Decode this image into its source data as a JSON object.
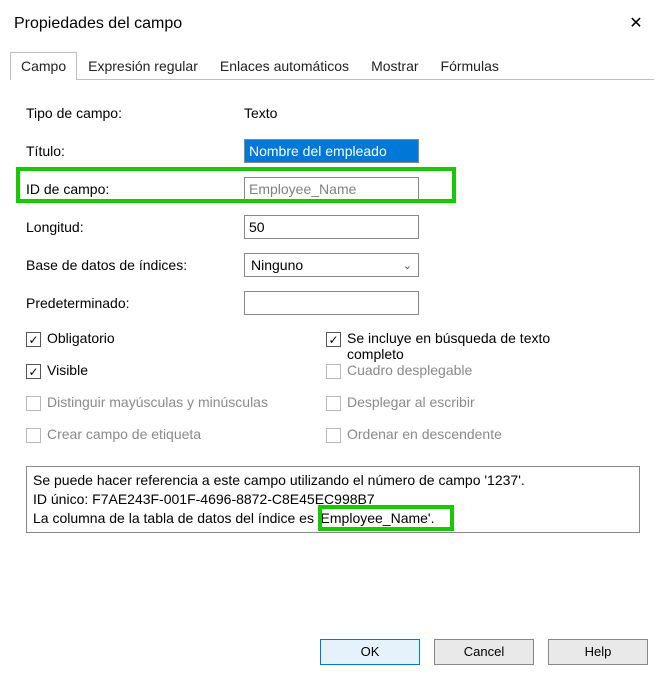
{
  "window": {
    "title": "Propiedades del campo"
  },
  "tabs": {
    "campo": "Campo",
    "regex": "Expresión regular",
    "enlaces": "Enlaces automáticos",
    "mostrar": "Mostrar",
    "formulas": "Fórmulas"
  },
  "form": {
    "tipo_label": "Tipo de campo:",
    "tipo_value": "Texto",
    "titulo_label": "Título:",
    "titulo_value": "Nombre del empleado",
    "id_label": "ID de campo:",
    "id_value": "Employee_Name",
    "longitud_label": "Longitud:",
    "longitud_value": "50",
    "db_label": "Base de datos de índices:",
    "db_value": "Ninguno",
    "pred_label": "Predeterminado:",
    "pred_value": ""
  },
  "checks": {
    "obligatorio": "Obligatorio",
    "incluye": "Se incluye en búsqueda de texto completo",
    "visible": "Visible",
    "desplegable": "Cuadro desplegable",
    "distinguir": "Distinguir mayúsculas y minúsculas",
    "desplegar": "Desplegar al escribir",
    "crear": "Crear campo de etiqueta",
    "ordenar": "Ordenar en descendente"
  },
  "info": {
    "line1a": "Se puede hacer referencia a este campo utilizando el número de campo '1237'.",
    "line2a": "ID único: F7AE243F-001F-4696-8872-C8E45EC998B7",
    "line3a": "La columna de la tabla de datos del índice es ",
    "line3b": "'Employee_Name'."
  },
  "buttons": {
    "ok": "OK",
    "cancel": "Cancel",
    "help": "Help"
  }
}
